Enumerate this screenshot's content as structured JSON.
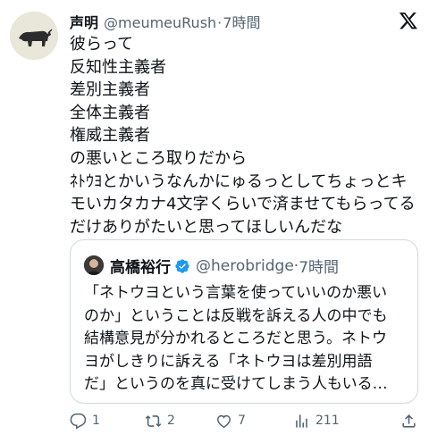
{
  "author": {
    "name": "声明",
    "handle": "@meumeuRush",
    "separator": "·",
    "time": "7時間"
  },
  "body_lines": [
    "彼らって",
    "反知性主義者",
    "差別主義者",
    "全体主義者",
    "権威主義者",
    "の悪いところ取りだから",
    "ﾈﾄｳﾖとかいうなんかにゅるっとしてちょっとキ",
    "モいカタカナ4文字くらいで済ませてもらってる",
    "だけありがたいと思ってほしいんだな"
  ],
  "quote": {
    "name": "高橋裕行",
    "handle": "@herobridge",
    "separator": "·",
    "time": "7時間",
    "lines": [
      "「ネトウヨという言葉を使っていいのか悪い",
      "のか」ということは反戦を訴える人の中でも",
      "結構意見が分かれるところだと思う。ネトウ",
      "ヨがしきりに訴える「ネトウヨは差別用語",
      "だ」というのを真に受けてしまう人もいる…"
    ]
  },
  "actions": {
    "replies": "1",
    "reposts": "2",
    "likes": "7",
    "views": "211"
  },
  "icons": {
    "logo": "x-logo-icon",
    "verified": "verified-badge-icon",
    "reply": "reply-icon",
    "repost": "repost-icon",
    "like": "heart-icon",
    "views": "views-icon",
    "share": "share-icon"
  },
  "colors": {
    "text": "#0f1419",
    "secondary": "#536471",
    "verified": "#1d9bf0",
    "border": "#cfd9de"
  }
}
